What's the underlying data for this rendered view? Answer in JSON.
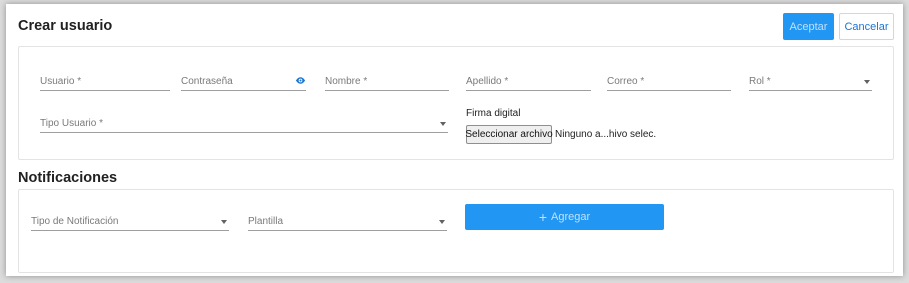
{
  "header": {
    "title": "Crear usuario",
    "accept_label": "Aceptar",
    "cancel_label": "Cancelar"
  },
  "user_form": {
    "usuario_label": "Usuario *",
    "contrasena_label": "Contraseña",
    "nombre_label": "Nombre *",
    "apellido_label": "Apellido *",
    "correo_label": "Correo *",
    "rol_label": "Rol *",
    "tipo_usuario_label": "Tipo Usuario *",
    "firma_label": "Firma digital",
    "file_button_label": "Seleccionar archivo",
    "file_status": "Ninguno a...hivo selec."
  },
  "notifications": {
    "title": "Notificaciones",
    "tipo_label": "Tipo de Notificación",
    "plantilla_label": "Plantilla",
    "add_button_label": "Agregar",
    "add_icon": "plus-icon"
  },
  "colors": {
    "primary": "#2196f3",
    "primary_text": "#bfe1fd",
    "link": "#1976d2"
  }
}
